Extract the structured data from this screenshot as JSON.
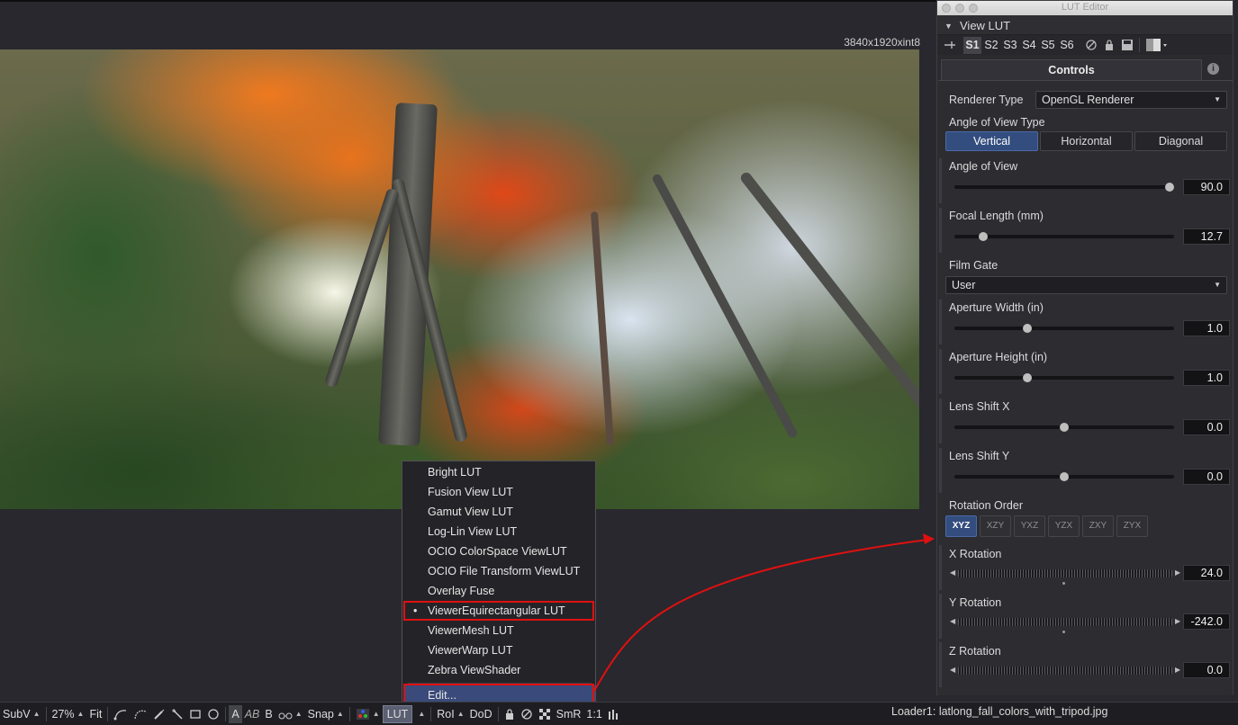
{
  "viewer": {
    "resolution": "3840x1920xint8"
  },
  "lut_menu": {
    "items": [
      {
        "label": "Bright LUT",
        "checked": false
      },
      {
        "label": "Fusion View LUT",
        "checked": false
      },
      {
        "label": "Gamut View LUT",
        "checked": false
      },
      {
        "label": "Log-Lin View LUT",
        "checked": false
      },
      {
        "label": "OCIO ColorSpace ViewLUT",
        "checked": false
      },
      {
        "label": "OCIO File Transform ViewLUT",
        "checked": false
      },
      {
        "label": "Overlay Fuse",
        "checked": false
      },
      {
        "label": "ViewerEquirectangular LUT",
        "checked": true
      },
      {
        "label": "ViewerMesh LUT",
        "checked": false
      },
      {
        "label": "ViewerWarp LUT",
        "checked": false
      },
      {
        "label": "Zebra ViewShader",
        "checked": false
      }
    ],
    "edit_label": "Edit...",
    "highlight_color": "#e01010"
  },
  "statusbar": {
    "subview": "SubV",
    "zoom": "27%",
    "fit": "Fit",
    "channel_a": "A",
    "channel_ab": "AB",
    "channel_b": "B",
    "snap": "Snap",
    "lut": "LUT",
    "roi": "RoI",
    "dod": "DoD",
    "smr": "SmR",
    "ratio": "1:1",
    "loader": "Loader1: latlong_fall_colors_with_tripod.jpg"
  },
  "lut_editor": {
    "window_title": "LUT Editor",
    "section": "View LUT",
    "slots": [
      "S1",
      "S2",
      "S3",
      "S4",
      "S5",
      "S6"
    ],
    "active_slot": "S1",
    "tab": "Controls",
    "info_icon": "i",
    "renderer_type_label": "Renderer Type",
    "renderer_type_value": "OpenGL Renderer",
    "aov_type_label": "Angle of View Type",
    "aov_types": [
      "Vertical",
      "Horizontal",
      "Diagonal"
    ],
    "aov_type_active": "Vertical",
    "angle_of_view": {
      "label": "Angle of View",
      "value": "90.0",
      "fraction": 0.98
    },
    "focal_length": {
      "label": "Focal Length (mm)",
      "value": "12.7",
      "fraction": 0.13
    },
    "film_gate_label": "Film Gate",
    "film_gate_value": "User",
    "aperture_width": {
      "label": "Aperture Width (in)",
      "value": "1.0",
      "fraction": 0.33
    },
    "aperture_height": {
      "label": "Aperture Height (in)",
      "value": "1.0",
      "fraction": 0.33
    },
    "lens_shift_x": {
      "label": "Lens Shift X",
      "value": "0.0",
      "fraction": 0.5
    },
    "lens_shift_y": {
      "label": "Lens Shift Y",
      "value": "0.0",
      "fraction": 0.5
    },
    "rotation_order_label": "Rotation Order",
    "rotation_orders": [
      "XYZ",
      "XZY",
      "YXZ",
      "YZX",
      "ZXY",
      "ZYX"
    ],
    "rotation_order_active": "XYZ",
    "x_rotation": {
      "label": "X Rotation",
      "value": "24.0"
    },
    "y_rotation": {
      "label": "Y Rotation",
      "value": "-242.0"
    },
    "z_rotation": {
      "label": "Z Rotation",
      "value": "0.0"
    }
  },
  "colors": {
    "accent": "#334d7e",
    "panel_bg": "#2c2c31",
    "annotation": "#e01010"
  }
}
